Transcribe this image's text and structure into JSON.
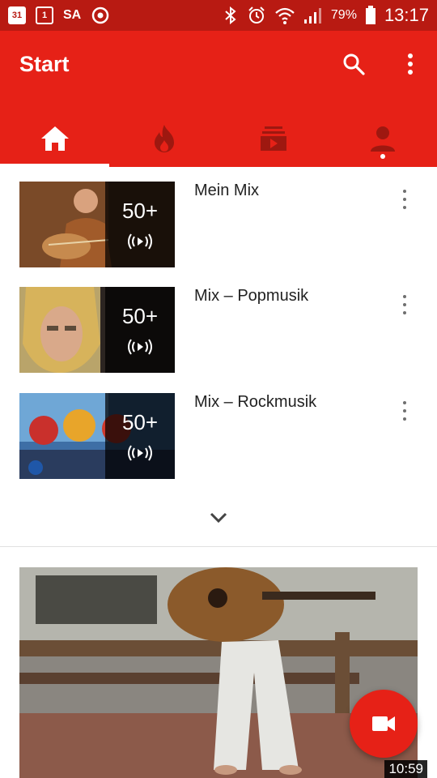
{
  "statusbar": {
    "cal1": "31",
    "cal2": "1",
    "sa": "SA",
    "battery": "79%",
    "time": "13:17"
  },
  "appbar": {
    "title": "Start"
  },
  "tabs": [
    {
      "icon": "home-icon",
      "active": true
    },
    {
      "icon": "trending-icon",
      "active": false
    },
    {
      "icon": "subscriptions-icon",
      "active": false
    },
    {
      "icon": "account-icon",
      "active": false
    }
  ],
  "mixes": [
    {
      "title": "Mein Mix",
      "count": "50+"
    },
    {
      "title": "Mix – Popmusik",
      "count": "50+"
    },
    {
      "title": "Mix – Rockmusik",
      "count": "50+"
    }
  ],
  "video": {
    "duration": "10:59"
  },
  "colors": {
    "statusbar": "#b81a12",
    "appbar": "#e62117",
    "inactive_icon": "#9e1810"
  }
}
